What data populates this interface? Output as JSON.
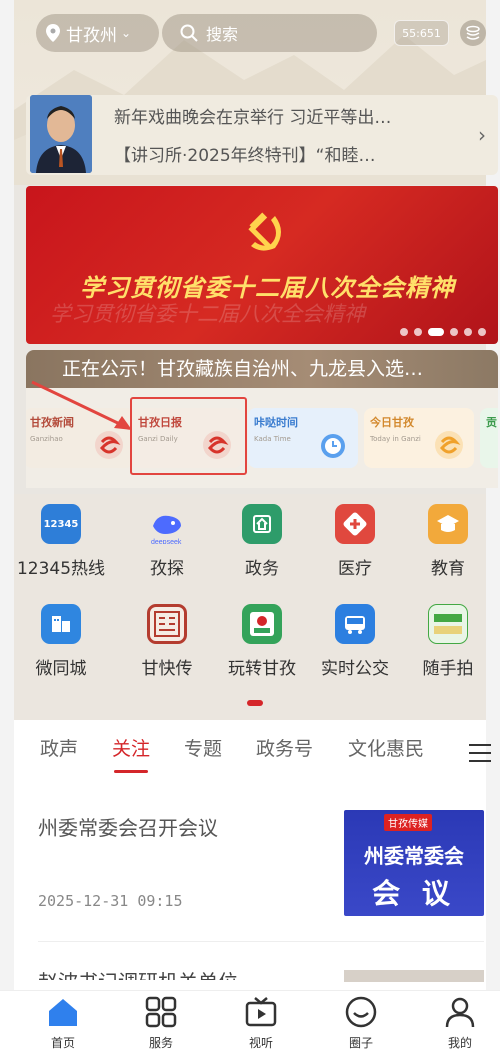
{
  "header": {
    "location": "甘孜州",
    "search_placeholder": "搜索",
    "weather_badge": "55:651"
  },
  "news_ticker": {
    "line1": "新年戏曲晚会在京举行 习近平等出…",
    "line2": "【讲习所·2025年终特刊】“和睦…"
  },
  "banner": {
    "title": "学习贯彻省委十二届八次全会精神",
    "ghost_text": "学习贯彻省委十二届八次全会精神",
    "dots": 6,
    "active_dot": 3
  },
  "notice": "正在公示！甘孜藏族自治州、九龙县入选…",
  "media_apps": [
    {
      "name": "甘孜新闻",
      "en": "Ganzihao"
    },
    {
      "name": "甘孜日报",
      "en": "Ganzi Daily"
    },
    {
      "name": "咔哒时间",
      "en": "Kada Time"
    },
    {
      "name": "今日甘孜",
      "en": "Today in Ganzi"
    },
    {
      "name": "贡",
      "en": ""
    }
  ],
  "services": [
    {
      "label": "12345热线",
      "icon": "hotline-12345-icon",
      "color": "#2e7ed8"
    },
    {
      "label": "孜探",
      "icon": "deepseek-whale-icon",
      "color": "#4d6bfe"
    },
    {
      "label": "政务",
      "icon": "government-icon",
      "color": "#2e9c6a"
    },
    {
      "label": "医疗",
      "icon": "medical-cross-icon",
      "color": "#e0483e"
    },
    {
      "label": "教育",
      "icon": "graduation-cap-icon",
      "color": "#f2a93b"
    },
    {
      "label": "微同城",
      "icon": "city-building-icon",
      "color": "#2f86e0"
    },
    {
      "label": "甘快传",
      "icon": "seal-stamp-icon",
      "color": "#b43c2f"
    },
    {
      "label": "玩转甘孜",
      "icon": "tourism-guide-icon",
      "color": "#34a35a"
    },
    {
      "label": "实时公交",
      "icon": "bus-icon",
      "color": "#2c7fe0"
    },
    {
      "label": "随手拍",
      "icon": "snapshot-icon",
      "color": "#43a843"
    }
  ],
  "tabs": [
    "政声",
    "关注",
    "专题",
    "政务号",
    "文化惠民"
  ],
  "active_tab": 1,
  "article": {
    "title": "州委常委会召开会议",
    "time": "2025-12-31 09:15",
    "thumb_badge": "甘孜传媒",
    "thumb_line1": "州委常委会",
    "thumb_line2": "会 议"
  },
  "article2_title": "赵波书记调研机关单位",
  "bottom_nav": [
    {
      "label": "首页",
      "icon": "home-icon"
    },
    {
      "label": "服务",
      "icon": "grid-services-icon"
    },
    {
      "label": "视听",
      "icon": "tv-play-icon"
    },
    {
      "label": "圈子",
      "icon": "smile-circle-icon"
    },
    {
      "label": "我的",
      "icon": "user-profile-icon"
    }
  ],
  "colors": {
    "accent": "#d4262a",
    "banner_red": "#c8151c",
    "home_blue": "#2f80ed"
  }
}
